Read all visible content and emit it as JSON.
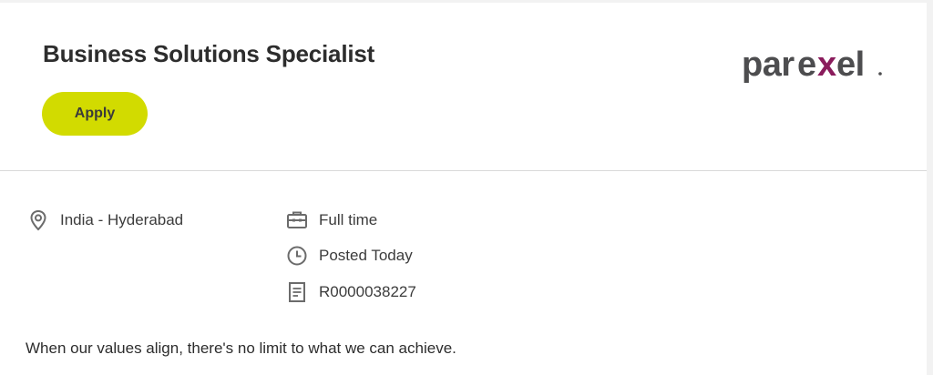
{
  "job": {
    "title": "Business Solutions Specialist",
    "apply_label": "Apply"
  },
  "brand": {
    "logo_text": "parexel",
    "logo_icon": "parexel-logo",
    "accent_color": "#d2db00",
    "logo_x_color": "#8a1c5c",
    "logo_text_color": "#4d4d4f"
  },
  "details": {
    "location": "India - Hyderabad",
    "employment_type": "Full time",
    "posted": "Posted Today",
    "requisition_id": "R0000038227",
    "icons": {
      "location": "map-pin-icon",
      "employment_type": "briefcase-icon",
      "posted": "clock-icon",
      "requisition_id": "document-icon"
    }
  },
  "description": {
    "tagline": "When our values align, there's no limit to what we can achieve."
  }
}
